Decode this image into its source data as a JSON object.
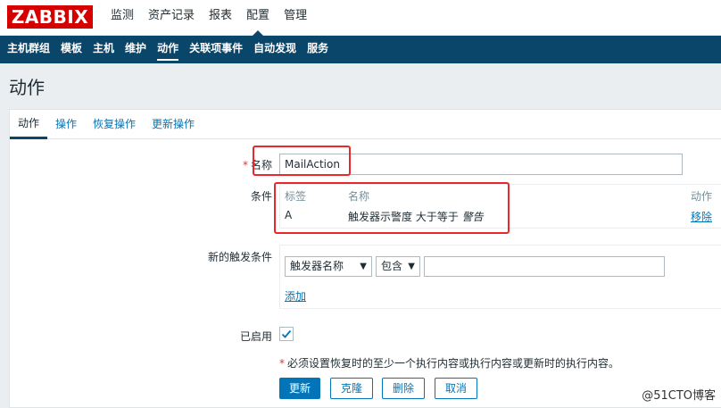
{
  "brand": {
    "logo_text": "ZABBIX",
    "logo_color": "#d40000"
  },
  "top_nav": [
    {
      "label": "监测",
      "active": false
    },
    {
      "label": "资产记录",
      "active": false
    },
    {
      "label": "报表",
      "active": false
    },
    {
      "label": "配置",
      "active": true
    },
    {
      "label": "管理",
      "active": false
    }
  ],
  "sub_nav": [
    {
      "label": "主机群组",
      "active": false
    },
    {
      "label": "模板",
      "active": false
    },
    {
      "label": "主机",
      "active": false
    },
    {
      "label": "维护",
      "active": false
    },
    {
      "label": "动作",
      "active": true
    },
    {
      "label": "关联项事件",
      "active": false
    },
    {
      "label": "自动发现",
      "active": false
    },
    {
      "label": "服务",
      "active": false
    }
  ],
  "page_title": "动作",
  "tabs": [
    {
      "label": "动作",
      "active": true
    },
    {
      "label": "操作",
      "active": false
    },
    {
      "label": "恢复操作",
      "active": false
    },
    {
      "label": "更新操作",
      "active": false
    }
  ],
  "form": {
    "name_required_mark": "*",
    "name_label": "名称",
    "name_value": "MailAction",
    "conditions_label": "条件",
    "conditions_headers": {
      "tag": "标签",
      "name": "名称",
      "action": "动作"
    },
    "conditions_rows": [
      {
        "tag": "A",
        "name_prefix": "触发器示警度 大于等于 ",
        "name_value": "警告",
        "remove_label": "移除"
      }
    ],
    "new_condition_label": "新的触发条件",
    "new_condition": {
      "type_selected": "触发器名称",
      "operator_selected": "包含",
      "value": "",
      "add_label": "添加"
    },
    "enabled_label": "已启用",
    "enabled_checked": true,
    "note_required_mark": "*",
    "note_text": "必须设置恢复时的至少一个执行内容或执行内容或更新时的执行内容。",
    "buttons": {
      "update": "更新",
      "clone": "克隆",
      "delete": "删除",
      "cancel": "取消"
    }
  },
  "watermark": "@51CTO博客",
  "colors": {
    "header_bg": "#0a466a",
    "link": "#0275b8",
    "annotation_red": "#e8282b"
  }
}
